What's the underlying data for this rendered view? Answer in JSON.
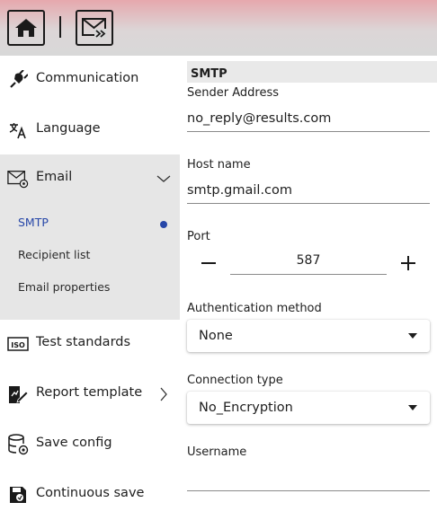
{
  "toolbar": {
    "home_icon": "home-icon",
    "mail_icon": "mail-forward-icon"
  },
  "sidebar": {
    "items": [
      {
        "label": "Communication",
        "icon": "plug-icon"
      },
      {
        "label": "Language",
        "icon": "translate-icon"
      },
      {
        "label": "Email",
        "icon": "email-settings-icon",
        "expanded": true
      },
      {
        "label": "Test standards",
        "icon": "iso-icon"
      },
      {
        "label": "Report template",
        "icon": "report-edit-icon"
      },
      {
        "label": "Save config",
        "icon": "database-settings-icon"
      },
      {
        "label": "Continuous save",
        "icon": "save-icon"
      }
    ],
    "email_subitems": [
      {
        "label": "SMTP",
        "active": true
      },
      {
        "label": "Recipient list",
        "active": false
      },
      {
        "label": "Email properties",
        "active": false
      }
    ]
  },
  "smtp": {
    "section_title": "SMTP",
    "sender_address_label": "Sender Address",
    "sender_address_value": "no_reply@results.com",
    "host_name_label": "Host name",
    "host_name_value": "smtp.gmail.com",
    "port_label": "Port",
    "port_value": "587",
    "auth_method_label": "Authentication method",
    "auth_method_value": "None",
    "connection_type_label": "Connection type",
    "connection_type_value": "No_Encryption",
    "username_label": "Username",
    "username_value": ""
  },
  "colors": {
    "accent": "#2747a8",
    "topbar_top": "#e6a8ad",
    "topbar_bottom": "#d8d8d8",
    "group_bg": "#e6e6e6"
  }
}
